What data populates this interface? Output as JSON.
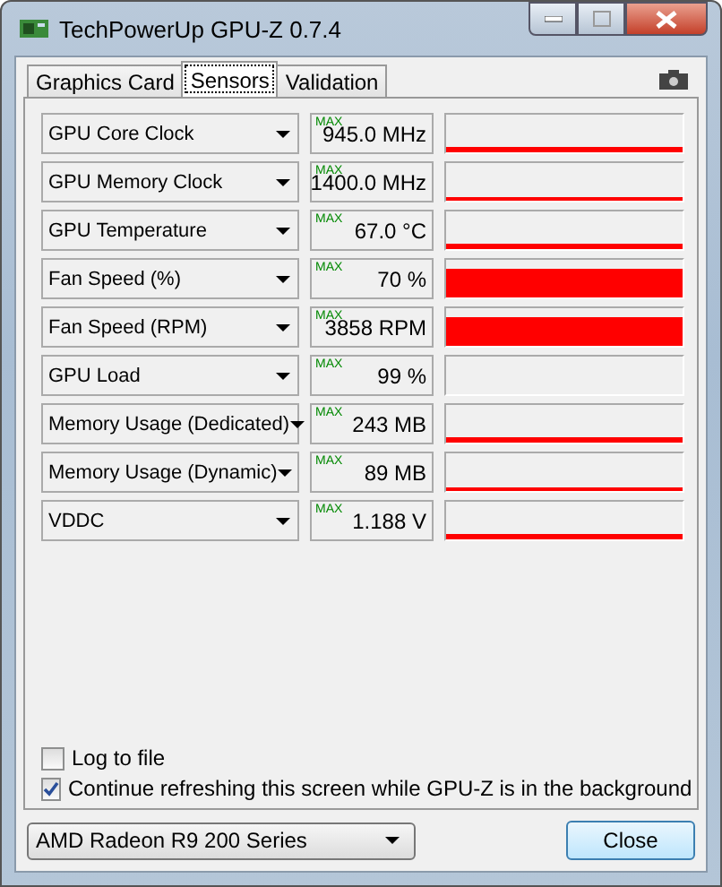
{
  "window": {
    "title": "TechPowerUp GPU-Z 0.7.4"
  },
  "tabs": [
    {
      "label": "Graphics Card",
      "selected": false
    },
    {
      "label": "Sensors",
      "selected": true
    },
    {
      "label": "Validation",
      "selected": false
    }
  ],
  "sensors": [
    {
      "name": "GPU Core Clock",
      "max_tag": "MAX",
      "reading": "945.0 MHz",
      "kind": "line"
    },
    {
      "name": "GPU Memory Clock",
      "max_tag": "MAX",
      "reading": "1400.0 MHz",
      "kind": "thin"
    },
    {
      "name": "GPU Temperature",
      "max_tag": "MAX",
      "reading": "67.0 °C",
      "kind": "line"
    },
    {
      "name": "Fan Speed (%)",
      "max_tag": "MAX",
      "reading": "70 %",
      "kind": "high"
    },
    {
      "name": "Fan Speed (RPM)",
      "max_tag": "MAX",
      "reading": "3858 RPM",
      "kind": "high"
    },
    {
      "name": "GPU Load",
      "max_tag": "MAX",
      "reading": "99 %",
      "kind": "empty"
    },
    {
      "name": "Memory Usage (Dedicated)",
      "max_tag": "MAX",
      "reading": "243 MB",
      "kind": "line"
    },
    {
      "name": "Memory Usage (Dynamic)",
      "max_tag": "MAX",
      "reading": "89 MB",
      "kind": "thin"
    },
    {
      "name": "VDDC",
      "max_tag": "MAX",
      "reading": "1.188 V",
      "kind": "line"
    }
  ],
  "options": [
    {
      "label": "Log to file",
      "checked": false
    },
    {
      "label": "Continue refreshing this screen while GPU-Z is in the background",
      "checked": true
    }
  ],
  "device_select": {
    "value": "AMD Radeon R9 200 Series"
  },
  "buttons": [
    "Close"
  ]
}
